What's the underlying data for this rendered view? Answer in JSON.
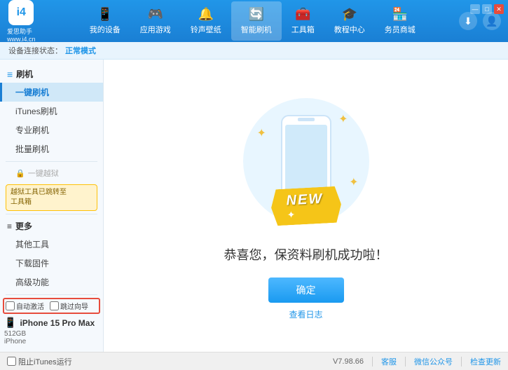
{
  "app": {
    "logo_text": "爱思助手",
    "logo_sub": "www.i4.cn",
    "logo_icon": "i4"
  },
  "nav": {
    "items": [
      {
        "id": "my-device",
        "label": "我的设备",
        "icon": "📱"
      },
      {
        "id": "apps-games",
        "label": "应用游戏",
        "icon": "🕹"
      },
      {
        "id": "ringtones",
        "label": "铃声壁纸",
        "icon": "🔔"
      },
      {
        "id": "smart-flash",
        "label": "智能刷机",
        "icon": "🔄",
        "active": true
      },
      {
        "id": "toolbox",
        "label": "工具箱",
        "icon": "🧰"
      },
      {
        "id": "tutorials",
        "label": "教程中心",
        "icon": "🎓"
      },
      {
        "id": "service",
        "label": "务员商城",
        "icon": "🏪"
      }
    ]
  },
  "header_right": {
    "download_icon": "⬇",
    "user_icon": "👤"
  },
  "win_controls": {
    "min": "—",
    "max": "□",
    "close": "✕"
  },
  "breadcrumb": {
    "prefix": "设备连接状态：",
    "status": "正常模式"
  },
  "sidebar": {
    "flash_section": {
      "label": "刷机",
      "icon": "📋"
    },
    "items": [
      {
        "id": "one-click-flash",
        "label": "一键刷机",
        "active": true
      },
      {
        "id": "itunes-flash",
        "label": "iTunes刷机"
      },
      {
        "id": "pro-flash",
        "label": "专业刷机"
      },
      {
        "id": "batch-flash",
        "label": "批量刷机"
      }
    ],
    "disabled_item": {
      "label": "一键越狱",
      "notice": "越狱工具已跳转至\n工具箱"
    },
    "more_section": {
      "label": "更多",
      "icon": "≡"
    },
    "more_items": [
      {
        "id": "other-tools",
        "label": "其他工具"
      },
      {
        "id": "download-firmware",
        "label": "下载固件"
      },
      {
        "id": "advanced",
        "label": "高级功能"
      }
    ]
  },
  "bottom_sidebar": {
    "auto_activate": "自动激活",
    "auto_backup": "跳过向导",
    "device_icon": "📱",
    "device_name": "iPhone 15 Pro Max",
    "device_storage": "512GB",
    "device_type": "iPhone"
  },
  "content": {
    "new_badge": "NEW",
    "success_text": "恭喜您，保资料刷机成功啦！",
    "confirm_button": "确定",
    "log_link": "查看日志"
  },
  "status_bar": {
    "itunes_label": "阻止iTunes运行",
    "version": "V7.98.66",
    "server": "客服",
    "wechat": "微信公众号",
    "check_update": "检查更新"
  }
}
